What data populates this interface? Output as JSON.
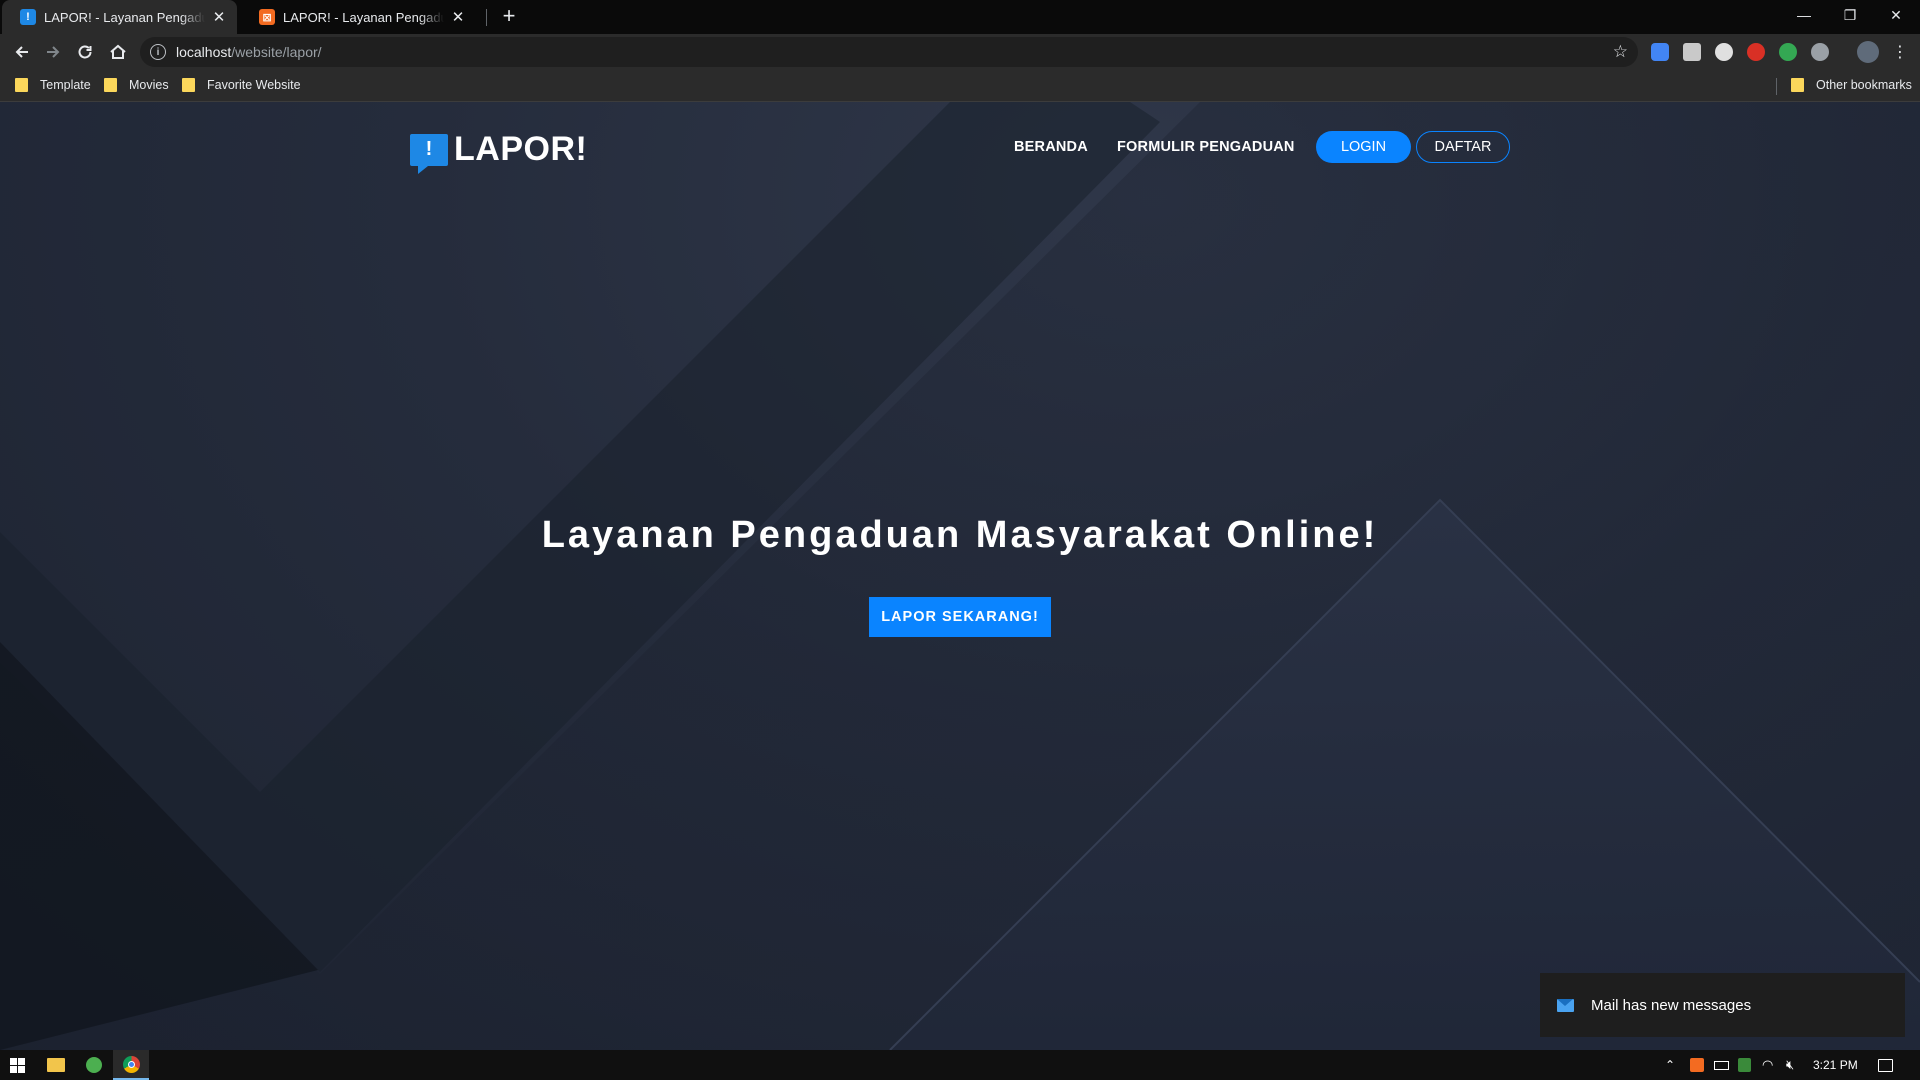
{
  "browser": {
    "tabs": [
      {
        "title": "LAPOR! - Layanan Pengaduan Masyarakat Online",
        "active": true,
        "favicon": "lapor-favicon"
      },
      {
        "title": "LAPOR! - Layanan Pengaduan Masyarakat Online",
        "active": false,
        "favicon": "xampp-favicon"
      }
    ],
    "new_tab": "+",
    "window_controls": {
      "minimize": "—",
      "restore": "❐",
      "close": "✕"
    },
    "address": {
      "host": "localhost",
      "path": "/website/lapor/"
    },
    "bookmarks": [
      {
        "label": "Template"
      },
      {
        "label": "Movies"
      },
      {
        "label": "Favorite Website"
      }
    ],
    "other_bookmarks": "Other bookmarks"
  },
  "site": {
    "brand": {
      "mark": "!",
      "name": "LAPOR!"
    },
    "nav": {
      "beranda": "BERANDA",
      "formulir": "FORMULIR PENGADUAN",
      "login": "LOGIN",
      "daftar": "DAFTAR"
    },
    "hero": {
      "title": "Layanan Pengaduan Masyarakat Online!",
      "cta": "LAPOR SEKARANG!"
    },
    "accent_color": "#0a84ff"
  },
  "notification": {
    "text": "Mail has new messages"
  },
  "taskbar": {
    "time": "3:21 PM"
  }
}
